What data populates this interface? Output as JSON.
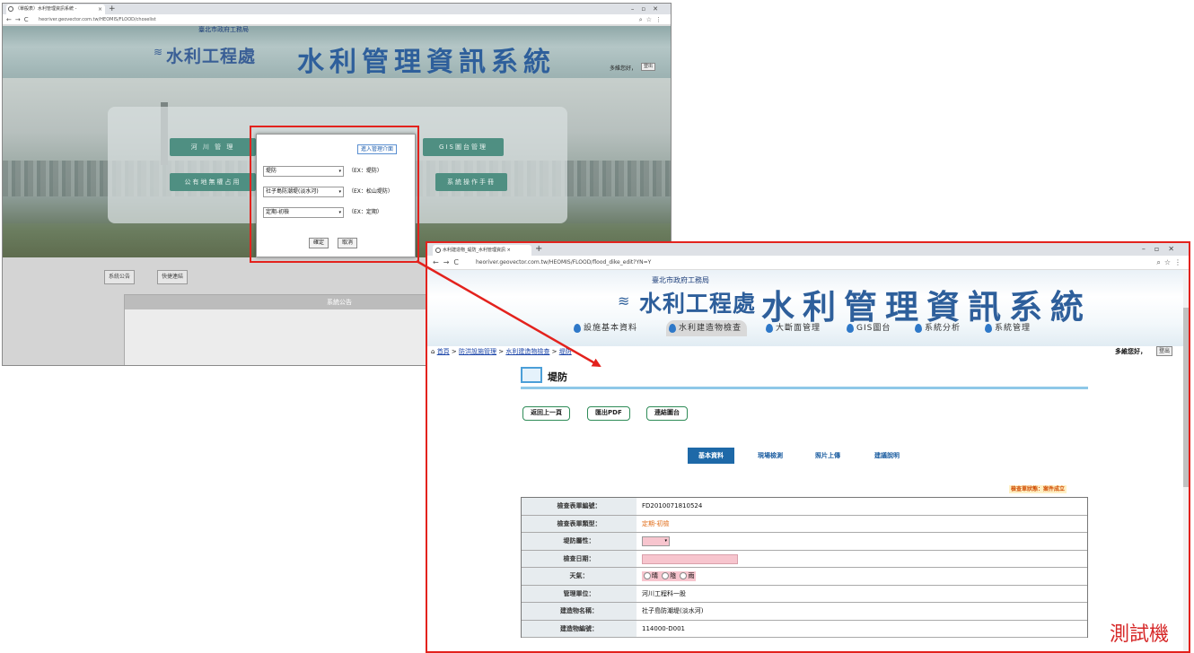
{
  "window1": {
    "tab_title": "（單般表）水利管理資訊系統 -",
    "url": "heoriver.geovector.com.tw/HEOMIS/FLOOD/choselist",
    "agency_small": "臺北市政府工務局",
    "agency_big": "水利工程處",
    "system_title": "水利管理資訊系統",
    "greeting": "多維您好，",
    "logout": "登出",
    "menu_buttons": [
      "河 川 管 理",
      "公有地無權占用",
      "GIS圖台管理",
      "系統操作手冊"
    ],
    "footer_tabs": [
      "系統公告",
      "快捷連結"
    ],
    "board_title": "系統公告"
  },
  "dialog": {
    "top_button": "進入管理介面",
    "selects": [
      {
        "value": "堤防",
        "hint": "（EX：堤防）"
      },
      {
        "value": "社子島防潮堤(淡水河)",
        "hint": "（EX：松山堤防）"
      },
      {
        "value": "定期-初檢",
        "hint": "（EX：定期）"
      }
    ],
    "confirm": "確定",
    "cancel": "取消"
  },
  "window2": {
    "tab_title": "水利建造物_堤防_水利管理資訊 ×",
    "url": "heoriver.geovector.com.tw/HEOMIS/FLOOD/flood_dike_edit?YN=Y",
    "agency_small": "臺北市政府工務局",
    "agency_big": "水利工程處",
    "system_title": "水利管理資訊系統",
    "menu": [
      "設施基本資料",
      "水利建造物檢查",
      "大斷面管理",
      "GIS圖台",
      "系統分析",
      "系統管理"
    ],
    "breadcrumb": {
      "home": "首頁",
      "sep": ">",
      "c1": "防洪設施管理",
      "c2": "水利建造物檢查",
      "c3": "堤防"
    },
    "greeting": "多維您好，",
    "logout": "登出",
    "page_title": "堤防",
    "actions": [
      "返回上一頁",
      "匯出PDF",
      "連結圖台"
    ],
    "tabs": [
      "基本資料",
      "現場檢測",
      "照片上傳",
      "建議說明"
    ],
    "status": "檢查單狀態：案件成立",
    "form": [
      {
        "label": "檢查表單編號：",
        "value": "FD2010071810524"
      },
      {
        "label": "檢查表單類型：",
        "value": "定期-初檢"
      },
      {
        "label": "堤防屬性：",
        "value": ""
      },
      {
        "label": "檢查日期：",
        "value": ""
      },
      {
        "label": "天氣：",
        "options": [
          "晴",
          "陰",
          "雨"
        ]
      },
      {
        "label": "管理單位：",
        "value": "河川工程科一股"
      },
      {
        "label": "建造物名稱：",
        "value": "社子島防潮堤(淡水河)"
      },
      {
        "label": "建造物編號：",
        "value": "114000-D001"
      }
    ],
    "watermark": "測試機"
  },
  "colors": {
    "highlight_red": "#e3221d",
    "button_green": "#2e8b57",
    "active_tab_blue": "#1e69a8",
    "required_pink": "#f7c5ce"
  }
}
